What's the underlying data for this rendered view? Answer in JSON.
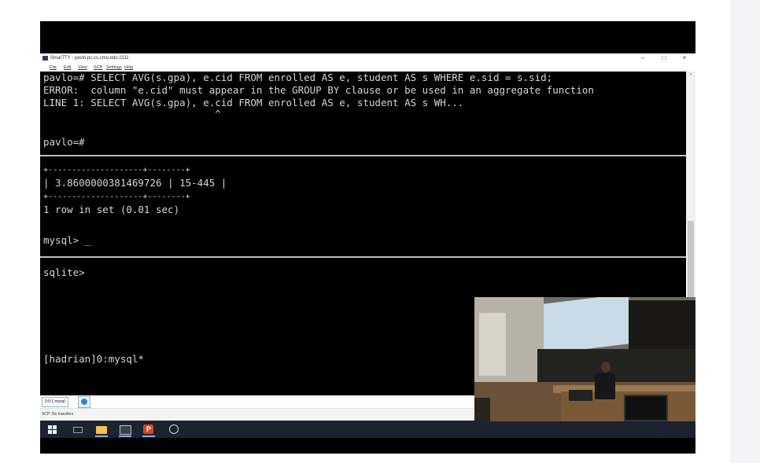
{
  "window": {
    "title": "SmarTTY - pavlo.pc.cs.cmu.edu:2111",
    "controls": {
      "minimize": "–",
      "maximize": "□",
      "close": "×"
    }
  },
  "menu": [
    "File",
    "Edit",
    "View",
    "SCP",
    "Settings",
    "Help"
  ],
  "terminal": {
    "lines": [
      "pavlo=# SELECT AVG(s.gpa), e.cid FROM enrolled AS e, student AS s WHERE e.sid = s.sid;",
      "ERROR:  column \"e.cid\" must appear in the GROUP BY clause or be used in an aggregate function",
      "LINE 1: SELECT AVG(s.gpa), e.cid FROM enrolled AS e, student AS s WH...",
      "                             ^",
      "",
      "pavlo=#",
      "+--------------------+--------+",
      "| 3.8600000381469726 | 15-445 |",
      "+--------------------+--------+",
      "1 row in set (0.01 sec)",
      "",
      "mysql> _",
      "sqlite>",
      "[hadrian]0:mysql*"
    ]
  },
  "tabs": {
    "active_label": "0:0:1.mysql"
  },
  "status": {
    "text": "SCP: No transfers"
  },
  "taskbar": {
    "icons": [
      "windows-start-icon",
      "task-view-icon",
      "file-explorer-icon",
      "terminal-icon",
      "powerpoint-icon",
      "clock-icon"
    ]
  },
  "colors": {
    "terminal_bg": "#000000",
    "terminal_fg": "#d6d6d6",
    "taskbar_bg": "#1c2230",
    "active_underline": "#7fb2ff"
  }
}
